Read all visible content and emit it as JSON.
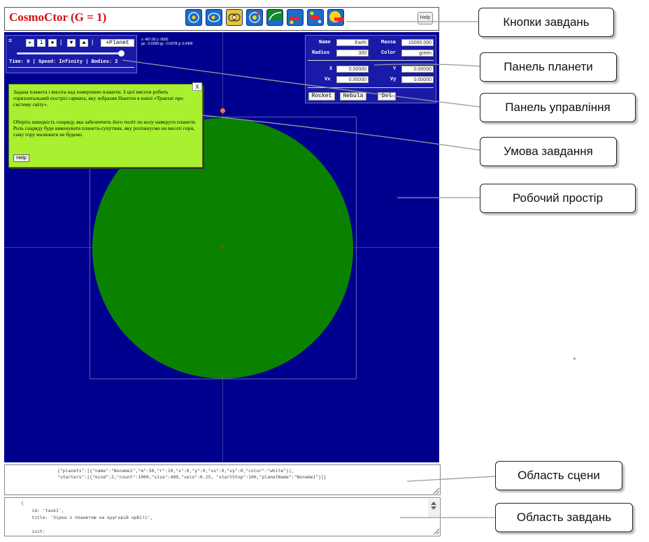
{
  "header": {
    "app_title": "CosmoCtor (G = 1)",
    "help_label": "Help",
    "task_icons": [
      "orbit-task-icon-1",
      "orbit-task-icon-2",
      "orbit-task-icon-3",
      "orbit-task-icon-4",
      "cannon-task-icon",
      "rocket-task-icon-1",
      "rocket-task-icon-2",
      "rocket-task-icon-3"
    ]
  },
  "control_panel": {
    "menu_glyph": "≡",
    "play_glyph": "▸",
    "step_label": "1",
    "dot_label": "●",
    "separator": "|",
    "down_glyph": "▼",
    "up_glyph": "▲",
    "add_planet_label": "+Planet",
    "coords_line1": "x: 487.00   y: 0600",
    "coords_line2": "gx: -0.0368   gy: -0.0078  g: 0.0406",
    "status": "Time: 0 | Speed: Infinity | Bodies: 2"
  },
  "planet_panel": {
    "name_label": "Name",
    "name_value": "Earth",
    "massa_label": "Massa",
    "massa_value": "10000.000",
    "radius_label": "Radius",
    "radius_value": "300",
    "color_label": "Color",
    "color_value": "green",
    "x_label": "X",
    "x_value": "0.00000",
    "y_label": "Y",
    "y_value": "0.00000",
    "vx_label": "Vx",
    "vx_value": "0.00000",
    "vy_label": "Vy",
    "vy_value": "0.00000",
    "rocket_label": "Rocket",
    "nebula_label": "Nebula",
    "del_label": "Del"
  },
  "task_popup": {
    "close_label": "X",
    "paragraph1": "Задана планета і висота над поверхнею планети. З цієї висоти робить горизонтальний постріл гармата, яку зобразив Ньютон в книзі «Трактат про систему світу».",
    "paragraph2": "Оберіть швидкість снаряду, яка забезпечить його політ по колу навкруги планети. Роль снаряду буде виконувати планета-супутник, яку розташуємо на висоті гори, саму гору малювати не будемо.",
    "help_label": "Help"
  },
  "scene_area": {
    "line1": "{\"planets\":[{\"name\":\"Noname1\",\"m\":50,\"r\":10,\"x\":0,\"y\":0,\"vx\":0,\"vy\":0,\"color\":\"white\"}],",
    "line2": "\"starters\":[{\"kind\":2,\"count\":1000,\"size\":400,\"velo\":0.25, \"startStop\":100,\"planetName\":\"Noname1\"}]}"
  },
  "tasks_area": {
    "line1": "{",
    "line2": "    id: 'task1',",
    "line3": "    title: 'Зірка з планетою на круговій орбіті',",
    "line4": "",
    "line5": "    init:"
  },
  "annotations": {
    "task_buttons": "Кнопки завдань",
    "planet_panel": "Панель планети",
    "control_panel": "Панель управління",
    "task_condition": "Умова завдання",
    "workspace": "Робочий простір",
    "scene_area": "Область сцени",
    "tasks_area": "Область завдань"
  },
  "colors": {
    "workspace": "#00008e",
    "planet": "#0a8200",
    "title": "#d01010",
    "popup": "#a8f030",
    "panel": "#1a1aa8"
  }
}
